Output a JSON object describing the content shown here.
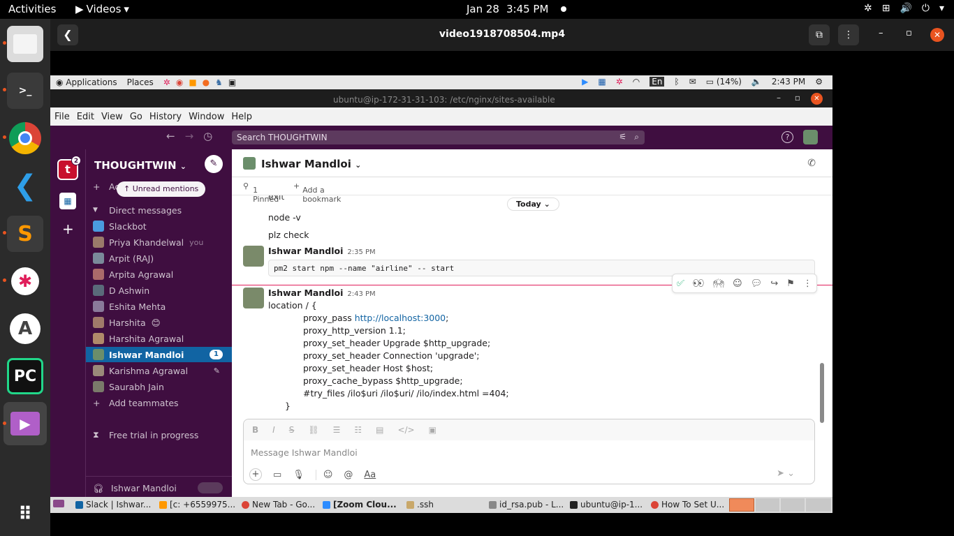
{
  "topbar": {
    "activities": "Activities",
    "app_menu": "Videos",
    "date": "Jan 28",
    "time": "3:45 PM"
  },
  "video_header": {
    "title": "video1918708504.mp4"
  },
  "xpanel": {
    "applications": "Applications",
    "places": "Places",
    "lang": "En",
    "battery": "(14%)",
    "time": "2:43 PM"
  },
  "window_title": "ubuntu@ip-172-31-31-103: /etc/nginx/sites-available",
  "menubar": [
    "File",
    "Edit",
    "View",
    "Go",
    "History",
    "Window",
    "Help"
  ],
  "search": {
    "placeholder": "Search THOUGHTWIN"
  },
  "rail": {
    "badge": "2"
  },
  "sidebar": {
    "workspace": "THOUGHTWIN",
    "unread_pill": "Unread mentions",
    "add_label": "Ac",
    "direct_messages": "Direct messages",
    "dms": [
      {
        "name": "Slackbot",
        "extra": ""
      },
      {
        "name": "Priya Khandelwal",
        "extra": "you"
      },
      {
        "name": "Arpit (RAJ)",
        "extra": ""
      },
      {
        "name": "Arpita Agrawal",
        "extra": ""
      },
      {
        "name": "D Ashwin",
        "extra": ""
      },
      {
        "name": "Eshita Mehta",
        "extra": ""
      },
      {
        "name": "Harshita",
        "extra": "😊"
      },
      {
        "name": "Harshita Agrawal",
        "extra": ""
      },
      {
        "name": "Ishwar Mandloi",
        "extra": "1"
      },
      {
        "name": "Karishma Agrawal",
        "extra": ""
      },
      {
        "name": "Saurabh Jain",
        "extra": ""
      }
    ],
    "add_teammates": "Add teammates",
    "free_trial": "Free trial in progress",
    "huddle_user": "Ishwar Mandloi"
  },
  "channel": {
    "name": "Ishwar Mandloi",
    "pinned": "1 Pinned",
    "add_bookmark": "Add a bookmark"
  },
  "messages": {
    "today": "Today",
    "prev_lines": [
      "exit",
      "node -v",
      "plz check"
    ],
    "msg1": {
      "author": "Ishwar Mandloi",
      "time": "2:35 PM",
      "code": "pm2 start npm --name \"airline\" -- start"
    },
    "msg2": {
      "author": "Ishwar Mandloi",
      "time": "2:43 PM",
      "line0": "location / {",
      "proxy_pass": "proxy_pass ",
      "proxy_pass_link": "http://localhost:3000",
      "proxy_pass_end": ";",
      "lines": [
        "proxy_http_version 1.1;",
        "proxy_set_header Upgrade $http_upgrade;",
        "proxy_set_header Connection 'upgrade';",
        "proxy_set_header Host $host;",
        "proxy_cache_bypass $http_upgrade;",
        "#try_files /ilo$uri /ilo$uri/ /ilo/index.html =404;"
      ],
      "close": "}"
    }
  },
  "composer": {
    "placeholder": "Message Ishwar Mandloi",
    "aa": "Aa"
  },
  "taskbar": [
    "Slack | Ishwar...",
    "[c: +6559975...",
    "New Tab - Go...",
    "[Zoom Clou...",
    ".ssh",
    "id_rsa.pub - L...",
    "ubuntu@ip-1...",
    "How To Set U..."
  ],
  "colors": {
    "slack_aubergine": "#3f0e40",
    "selected": "#1164a3",
    "ubuntu_orange": "#e95420"
  }
}
